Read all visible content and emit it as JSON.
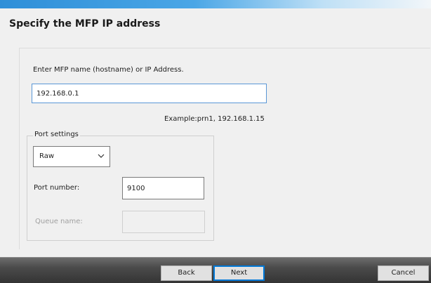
{
  "page": {
    "title": "Specify the MFP IP address"
  },
  "host": {
    "prompt": "Enter MFP name (hostname) or IP Address.",
    "value": "192.168.0.1",
    "example": "Example:prn1, 192.168.1.15"
  },
  "port_settings": {
    "legend": "Port settings",
    "protocol": {
      "selected": "Raw",
      "icon": "chevron-down-icon"
    },
    "port_number_label": "Port number:",
    "port_number_value": "9100",
    "queue_name_label": "Queue name:",
    "queue_name_value": ""
  },
  "footer": {
    "back_label": "Back",
    "next_label": "Next",
    "cancel_label": "Cancel"
  },
  "colors": {
    "accent": "#0078d7",
    "input_focus_border": "#5a97d6",
    "disabled_text": "#a0a0a0",
    "footer_bg": "#3c3c3c"
  }
}
